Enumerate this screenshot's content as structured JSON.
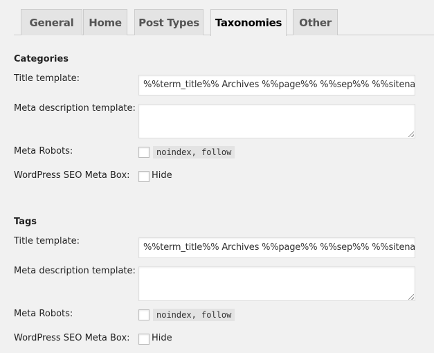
{
  "tabs": [
    {
      "label": "General",
      "active": false
    },
    {
      "label": "Home",
      "active": false
    },
    {
      "label": "Post Types",
      "active": false
    },
    {
      "label": "Taxonomies",
      "active": true
    },
    {
      "label": "Other",
      "active": false
    }
  ],
  "sections": [
    {
      "title": "Categories",
      "title_template_label": "Title template:",
      "title_template_value": "%%term_title%% Archives %%page%% %%sep%% %%sitename%%",
      "meta_description_label": "Meta description template:",
      "meta_description_value": "",
      "meta_robots_label": "Meta Robots:",
      "meta_robots_checked": false,
      "meta_robots_option": "noindex, follow",
      "meta_box_label": "WordPress SEO Meta Box:",
      "meta_box_checked": false,
      "meta_box_option": "Hide"
    },
    {
      "title": "Tags",
      "title_template_label": "Title template:",
      "title_template_value": "%%term_title%% Archives %%page%% %%sep%% %%sitename%%",
      "meta_description_label": "Meta description template:",
      "meta_description_value": "",
      "meta_robots_label": "Meta Robots:",
      "meta_robots_checked": false,
      "meta_robots_option": "noindex, follow",
      "meta_box_label": "WordPress SEO Meta Box:",
      "meta_box_checked": false,
      "meta_box_option": "Hide"
    }
  ]
}
